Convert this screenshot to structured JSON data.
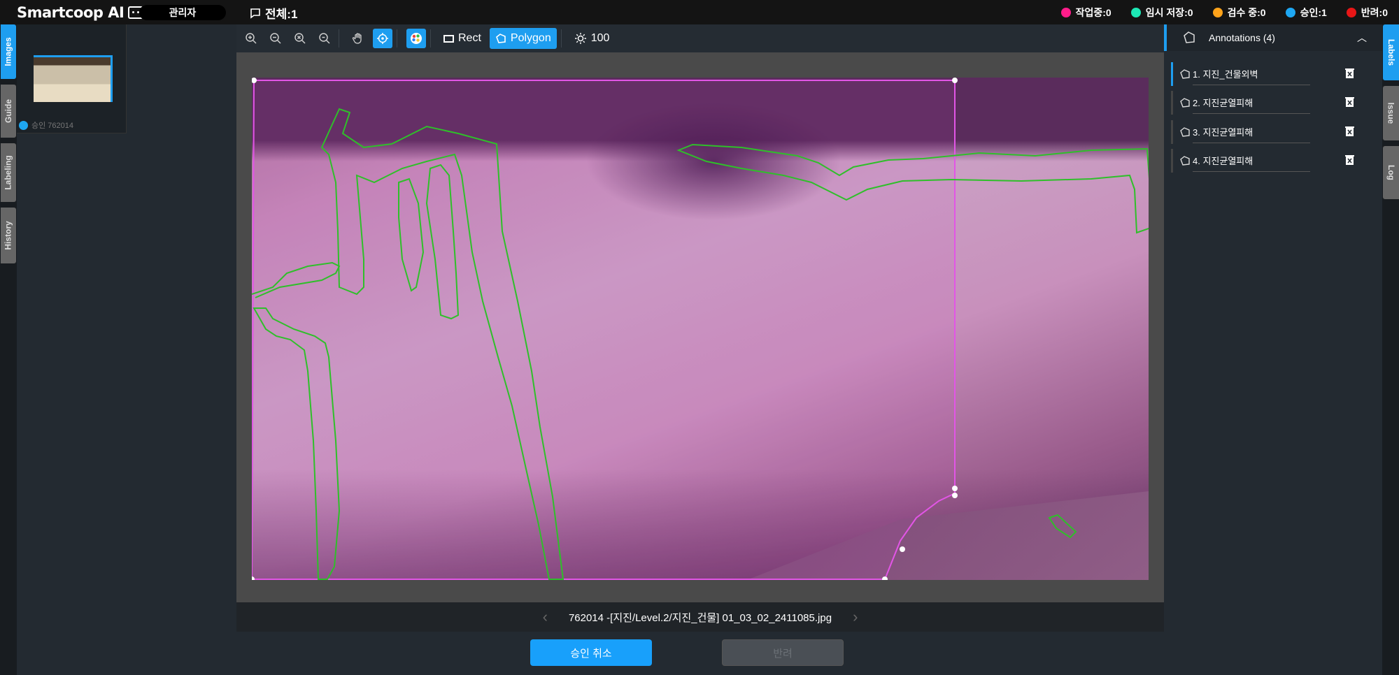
{
  "app": {
    "logo_text": "Smartcoop AI",
    "role": "관리자",
    "total_label": "전체:1"
  },
  "status_counts": [
    {
      "label": "작업중:0",
      "color": "#ff1c8a"
    },
    {
      "label": "임시 저장:0",
      "color": "#1de9b6"
    },
    {
      "label": "검수 중:0",
      "color": "#ffa31a"
    },
    {
      "label": "승인:1",
      "color": "#1ea7f2"
    },
    {
      "label": "반려:0",
      "color": "#e81616"
    }
  ],
  "left_tabs": [
    {
      "label": "Images",
      "icon": "image-icon",
      "active": true
    },
    {
      "label": "Guide",
      "icon": "pen-icon",
      "active": false
    },
    {
      "label": "Labeling",
      "icon": "tag-icon",
      "active": false
    },
    {
      "label": "History",
      "icon": "document-icon",
      "active": false
    }
  ],
  "thumbnail": {
    "caption": "승인 762014",
    "status_color": "#1ea7f2"
  },
  "toolbar": {
    "rect_label": "Rect",
    "polygon_label": "Polygon",
    "brightness_value": "100"
  },
  "image": {
    "filename": "762014 -[지진/Level.2/지진_건물] 01_03_02_2411085.jpg"
  },
  "actions": {
    "primary_label": "승인 취소",
    "disabled_label": "반려"
  },
  "annotations": {
    "header": "Annotations (4)",
    "items": [
      {
        "label": "1. 지진_건물외벽",
        "active": true
      },
      {
        "label": "2. 지진균열피해",
        "active": false
      },
      {
        "label": "3. 지진균열피해",
        "active": false
      },
      {
        "label": "4. 지진균열피해",
        "active": false
      }
    ]
  },
  "right_tabs": [
    {
      "label": "Labels",
      "icon": "label-icon",
      "active": true
    },
    {
      "label": "Issue",
      "icon": "pen-icon",
      "active": false
    },
    {
      "label": "Log",
      "icon": "pen-icon",
      "active": false
    }
  ]
}
